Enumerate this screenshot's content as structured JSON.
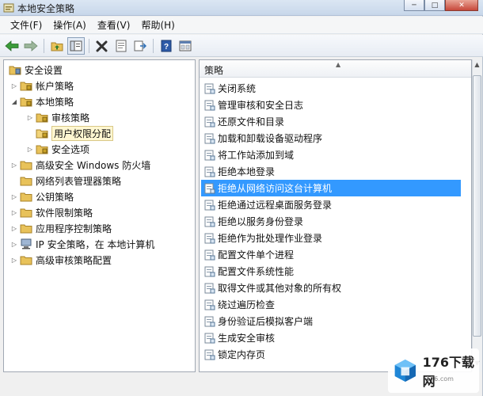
{
  "window": {
    "title": "本地安全策略"
  },
  "menu": [
    {
      "label": "文件(F)"
    },
    {
      "label": "操作(A)"
    },
    {
      "label": "查看(V)"
    },
    {
      "label": "帮助(H)"
    }
  ],
  "toolbar": {
    "buttons": [
      "back-icon",
      "forward-icon",
      "up-folder-icon",
      "show-tree-icon",
      "delete-icon",
      "properties-icon",
      "export-icon",
      "help-icon",
      "console-icon"
    ]
  },
  "tree": {
    "root": "安全设置",
    "items": [
      {
        "label": "帐户策略",
        "expanded": false
      },
      {
        "label": "本地策略",
        "expanded": true
      },
      {
        "label": "审核策略",
        "expanded": false
      },
      {
        "label": "用户权限分配",
        "selected": true
      },
      {
        "label": "安全选项",
        "expanded": false
      },
      {
        "label": "高级安全 Windows 防火墙",
        "expanded": false
      },
      {
        "label": "网络列表管理器策略"
      },
      {
        "label": "公钥策略",
        "expanded": false
      },
      {
        "label": "软件限制策略",
        "expanded": false
      },
      {
        "label": "应用程序控制策略",
        "expanded": false
      },
      {
        "label": "IP 安全策略，在 本地计算机",
        "expanded": false
      },
      {
        "label": "高级审核策略配置",
        "expanded": false
      }
    ]
  },
  "list": {
    "header": "策略",
    "items": [
      {
        "label": "关闭系统"
      },
      {
        "label": "管理审核和安全日志"
      },
      {
        "label": "还原文件和目录"
      },
      {
        "label": "加载和卸载设备驱动程序"
      },
      {
        "label": "将工作站添加到域"
      },
      {
        "label": "拒绝本地登录"
      },
      {
        "label": "拒绝从网络访问这台计算机",
        "selected": true
      },
      {
        "label": "拒绝通过远程桌面服务登录"
      },
      {
        "label": "拒绝以服务身份登录"
      },
      {
        "label": "拒绝作为批处理作业登录"
      },
      {
        "label": "配置文件单个进程"
      },
      {
        "label": "配置文件系统性能"
      },
      {
        "label": "取得文件或其他对象的所有权"
      },
      {
        "label": "绕过遍历检查"
      },
      {
        "label": "身份验证后模拟客户端"
      },
      {
        "label": "生成安全审核"
      },
      {
        "label": "锁定内存页"
      }
    ]
  },
  "watermark": {
    "brand": "176下载网",
    "url": "176.com"
  },
  "colors": {
    "selection": "#3399ff",
    "tree_selected": "#fff7d1"
  }
}
